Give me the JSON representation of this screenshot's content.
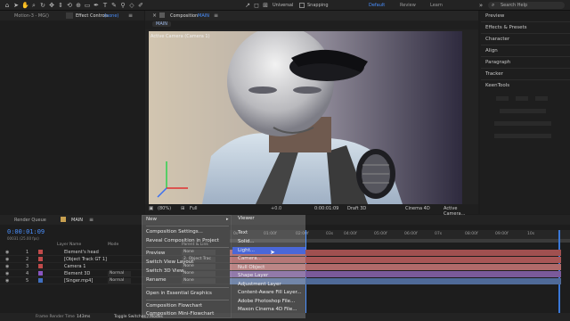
{
  "toolbar": {
    "universal_label": "Universal",
    "snapping_label": "Snapping",
    "workspaces": [
      "Default",
      "Review",
      "Learn"
    ],
    "active_workspace": "Default",
    "search_placeholder": "Search Help",
    "accent": "#4a90ff"
  },
  "left_panel": {
    "tab_project": "Motion-3 - MG()",
    "tab_effect_controls": "Effect Controls",
    "tab_effect_controls_value": "(none)"
  },
  "comp_panel": {
    "tab_label": "Composition",
    "tab_value": "MAIN",
    "breadcrumb": "MAIN",
    "camera_label": "Active Camera (Camera 1)",
    "zoom": "(80%)",
    "resolution": "Full",
    "timecode": "0:00:01:09",
    "renderer": "Draft 3D",
    "renderer_name": "Cinema 4D",
    "view": "Active Camera...",
    "exposure": "+0.0"
  },
  "right_panel": {
    "items": [
      "Preview",
      "Effects & Presets",
      "Character",
      "Align",
      "Paragraph",
      "Tracker",
      "KeenTools"
    ]
  },
  "timeline": {
    "tab_render_queue": "Render Queue",
    "tab_main": "MAIN",
    "current_time": "0:00:01:09",
    "frame_info": "00031 (25.00 fps)",
    "col_layer_name": "Layer Name",
    "col_mode": "Mode",
    "col_parent": "Parent & Link",
    "ruler_ticks": [
      "0s",
      "01:00f",
      "02:00f",
      "03s",
      "04:00f",
      "05:00f",
      "06:00f",
      "07s",
      "08:00f",
      "09:00f",
      "10s"
    ],
    "layers": [
      {
        "num": "1",
        "name": "Element's head",
        "mode": "",
        "parent": "None",
        "label_color": "#c04a4a"
      },
      {
        "num": "2",
        "name": "[Object Track GT 1]",
        "mode": "",
        "parent": "2. Object Trac",
        "label_color": "#c04a4a"
      },
      {
        "num": "3",
        "name": "Camera 1",
        "mode": "",
        "parent": "None",
        "label_color": "#c04a4a"
      },
      {
        "num": "4",
        "name": "Element 3D",
        "mode": "Normal",
        "parent": "None",
        "label_color": "#8a55c0"
      },
      {
        "num": "5",
        "name": "[Singer.mp4]",
        "mode": "Normal",
        "parent": "None",
        "label_color": "#3f6fbf"
      }
    ],
    "footer_render_label": "Frame Render Time",
    "footer_render_value": "143ms",
    "footer_toggle": "Toggle Switches / Modes"
  },
  "context_menu": {
    "items": [
      "New",
      "Composition Settings...",
      "Reveal Composition in Project",
      "Preview",
      "Switch View Layout",
      "Switch 3D View",
      "Rename",
      "Open in Essential Graphics",
      "Composition Flowchart",
      "Composition Mini-Flowchart"
    ]
  },
  "submenu": {
    "items": [
      "Viewer",
      "Text",
      "Solid...",
      "Light...",
      "Camera...",
      "Null Object",
      "Shape Layer",
      "Adjustment Layer",
      "Content-Aware Fill Layer...",
      "Adobe Photoshop File...",
      "Maxon Cinema 4D File..."
    ],
    "highlighted": "Light...",
    "highlight_color": "#4a67d8"
  }
}
